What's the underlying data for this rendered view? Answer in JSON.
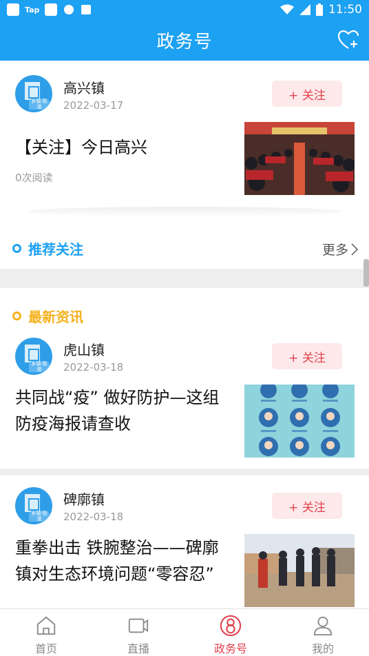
{
  "status_bar": {
    "tap_label": "Tap",
    "time": "11:50"
  },
  "header": {
    "title": "政务号"
  },
  "featured": {
    "org_name": "高兴镇",
    "date": "2022-03-17",
    "follow_label": "+ 关注",
    "headline": "【关注】今日高兴",
    "reads": "0次阅读"
  },
  "recommend": {
    "title": "推荐关注",
    "more_label": "更多"
  },
  "latest": {
    "title": "最新资讯"
  },
  "news": [
    {
      "org_name": "虎山镇",
      "date": "2022-03-18",
      "follow_label": "+ 关注",
      "headline": "共同战“疫” 做好防护—这组防疫海报请查收"
    },
    {
      "org_name": "碑廓镇",
      "date": "2022-03-18",
      "follow_label": "+ 关注",
      "headline": "重拳出击 铁腕整治——碑廓镇对生态环境问题“零容忍”"
    }
  ],
  "avatar_tag": "乡镇·街道",
  "tabs": [
    {
      "label": "首页",
      "icon": "home-icon"
    },
    {
      "label": "直播",
      "icon": "video-icon"
    },
    {
      "label": "政务号",
      "icon": "gov-icon"
    },
    {
      "label": "我的",
      "icon": "user-icon"
    }
  ],
  "colors": {
    "brand": "#1da1f2",
    "accent_red": "#e0414d",
    "gold": "#f5b21f"
  }
}
